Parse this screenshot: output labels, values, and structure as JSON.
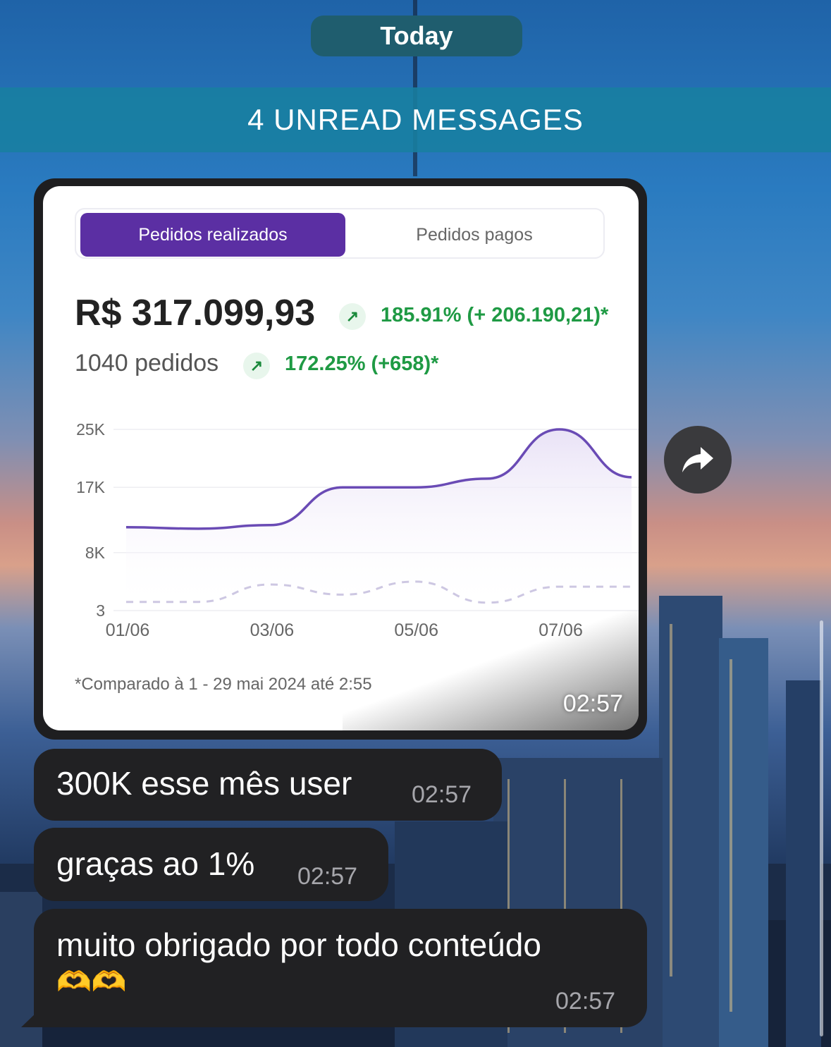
{
  "date_separator": "Today",
  "unread_banner": "4 UNREAD MESSAGES",
  "image_message": {
    "tabs": [
      "Pedidos realizados",
      "Pedidos pagos"
    ],
    "active_tab": "Pedidos realizados",
    "revenue": "R$ 317.099,93",
    "revenue_growth": "185.91% (+ 206.190,21)*",
    "orders": "1040 pedidos",
    "orders_growth": "172.25% (+658)*",
    "trend_icon": "arrow-up-right-icon",
    "footnote": "*Comparado à 1 - 29 mai 2024 até 2:55",
    "time": "02:57",
    "chart_data": {
      "type": "area",
      "y_tick_labels": [
        "25K",
        "17K",
        "8K",
        "3"
      ],
      "x_tick_labels": [
        "01/06",
        "03/06",
        "05/06",
        "07/06"
      ],
      "series": [
        {
          "style": "solid-area",
          "color": "#6a4bb5",
          "x": [
            "01/06",
            "02/06",
            "03/06",
            "04/06",
            "05/06",
            "06/06",
            "07/06",
            "07/06 end"
          ],
          "values": [
            11500,
            11300,
            11800,
            17000,
            17000,
            18200,
            25000,
            18400
          ]
        },
        {
          "style": "dashed",
          "color": "#cdc7e2",
          "x": [
            "01/06",
            "02/06",
            "03/06",
            "04/06",
            "05/06",
            "06/06",
            "07/06",
            "07/06 end"
          ],
          "values": [
            1200,
            1200,
            3600,
            2200,
            4000,
            1100,
            3300,
            3300
          ]
        }
      ]
    }
  },
  "messages": [
    {
      "text": "300K esse mês user",
      "time": "02:57"
    },
    {
      "text": "graças ao 1%",
      "time": "02:57"
    },
    {
      "text": "muito obrigado por todo conteúdo",
      "emoji": "🫶🫶",
      "time": "02:57"
    }
  ],
  "forward_icon": "share-forward-icon"
}
